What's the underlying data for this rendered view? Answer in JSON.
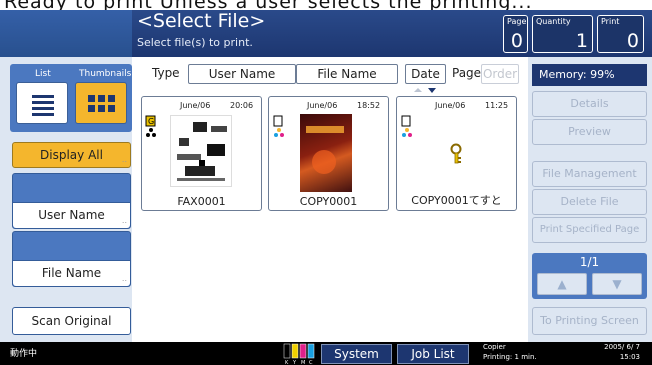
{
  "top_text": "Ready to print   Unless a user selects the printing...",
  "header": {
    "title": "<Select File>",
    "subtitle": "Select file(s) to print.",
    "page_label": "Page",
    "page_value": "0",
    "quantity_label": "Quantity",
    "quantity_value": "1",
    "print_label": "Print",
    "print_value": "0"
  },
  "left_panel": {
    "list_tab": "List",
    "thumbnails_tab": "Thumbnails",
    "display_all": "Display All",
    "user_name": "User Name",
    "file_name": "File Name",
    "scan_original": "Scan Original"
  },
  "columns": {
    "type_label": "Type",
    "user_name": "User Name",
    "file_name": "File Name",
    "date": "Date",
    "page_label": "Page",
    "order": "Order"
  },
  "files": [
    {
      "date": "June/06",
      "time": "20:06",
      "name": "FAX0001"
    },
    {
      "date": "June/06",
      "time": "18:52",
      "name": "COPY0001"
    },
    {
      "date": "June/06",
      "time": "11:25",
      "name": "COPY0001てすと"
    }
  ],
  "right_panel": {
    "memory": "Memory:  99%",
    "details": "Details",
    "preview": "Preview",
    "file_management": "File Management",
    "delete_file": "Delete File",
    "print_specified_page": "Print Specified Page",
    "page_indicator": "1/1",
    "up_arrow": "▲",
    "down_arrow": "▼",
    "to_printing_screen": "To Printing Screen"
  },
  "status_bar": {
    "status": "動作中",
    "system_status": "System Status",
    "job_list": "Job List",
    "copier_line1": "Copier",
    "copier_line2": "Printing: 1 min.",
    "date": "2005/ 6/ 7",
    "time": "15:03",
    "toner_labels": [
      "K",
      "Y",
      "M",
      "C"
    ],
    "toner_colors": [
      "#000000",
      "#f0d000",
      "#e0208a",
      "#1aa0e0"
    ]
  },
  "colors": {
    "header_blue": "#1d3670",
    "panel_blue": "#4b78c0",
    "accent_yellow": "#f4b62d"
  }
}
